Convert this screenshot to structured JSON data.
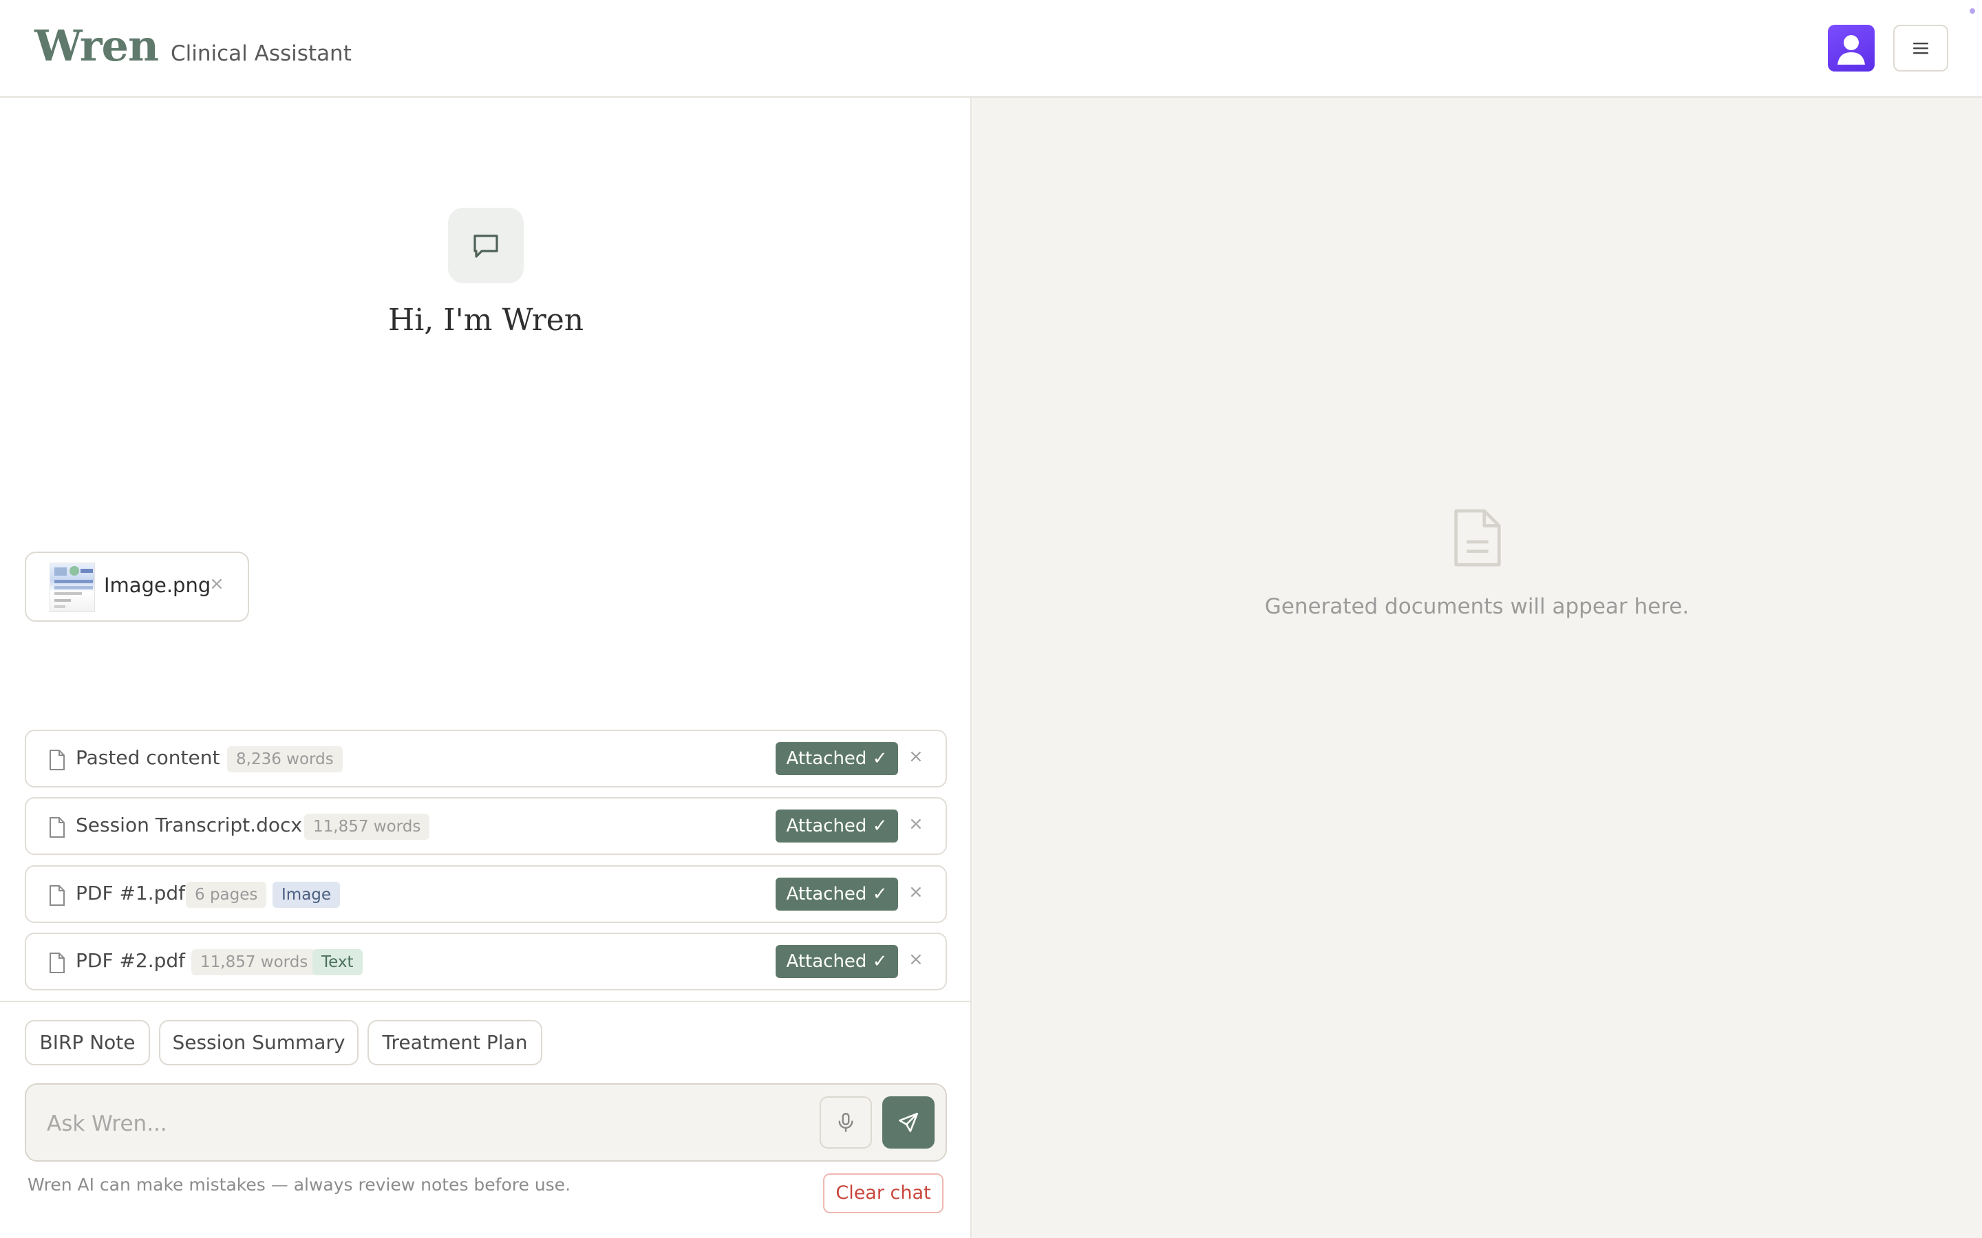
{
  "header": {
    "logo": "Wren",
    "subtitle": "Clinical Assistant"
  },
  "icons": {
    "avatar": "user-avatar-icon",
    "menu": "hamburger-menu-icon",
    "chat": "chat-bubble-icon",
    "file": "file-icon",
    "mic": "microphone-icon",
    "send": "send-icon",
    "document": "document-icon"
  },
  "colors": {
    "brand": "#5f7a6c",
    "attached_badge": "#5d786a",
    "avatar": "#6a3cf5",
    "clear_chat": "#c9463d",
    "panel_bg": "#f4f3ef"
  },
  "chat": {
    "greeting": "Hi, I'm Wren"
  },
  "image_attachment": {
    "name": "Image.png",
    "remove": "×"
  },
  "files": [
    {
      "name": "Pasted content",
      "count": "8,236 words",
      "tag": "",
      "status": "Attached ✓",
      "remove": "×"
    },
    {
      "name": "Session Transcript.docx",
      "count": "11,857 words",
      "tag": "",
      "status": "Attached ✓",
      "remove": "×"
    },
    {
      "name": "PDF #1.pdf",
      "count": "6 pages",
      "tag": "Image",
      "status": "Attached ✓",
      "remove": "×"
    },
    {
      "name": "PDF #2.pdf",
      "count": "11,857 words",
      "tag": "Text",
      "status": "Attached ✓",
      "remove": "×"
    }
  ],
  "quick_actions": [
    "BIRP Note",
    "Session Summary",
    "Treatment Plan"
  ],
  "input": {
    "placeholder": "Ask Wren...",
    "value": ""
  },
  "footer": {
    "disclaimer": "Wren AI can make mistakes — always review notes before use.",
    "clear_label": "Clear chat"
  },
  "documents_panel": {
    "empty_text": "Generated documents will appear here."
  }
}
